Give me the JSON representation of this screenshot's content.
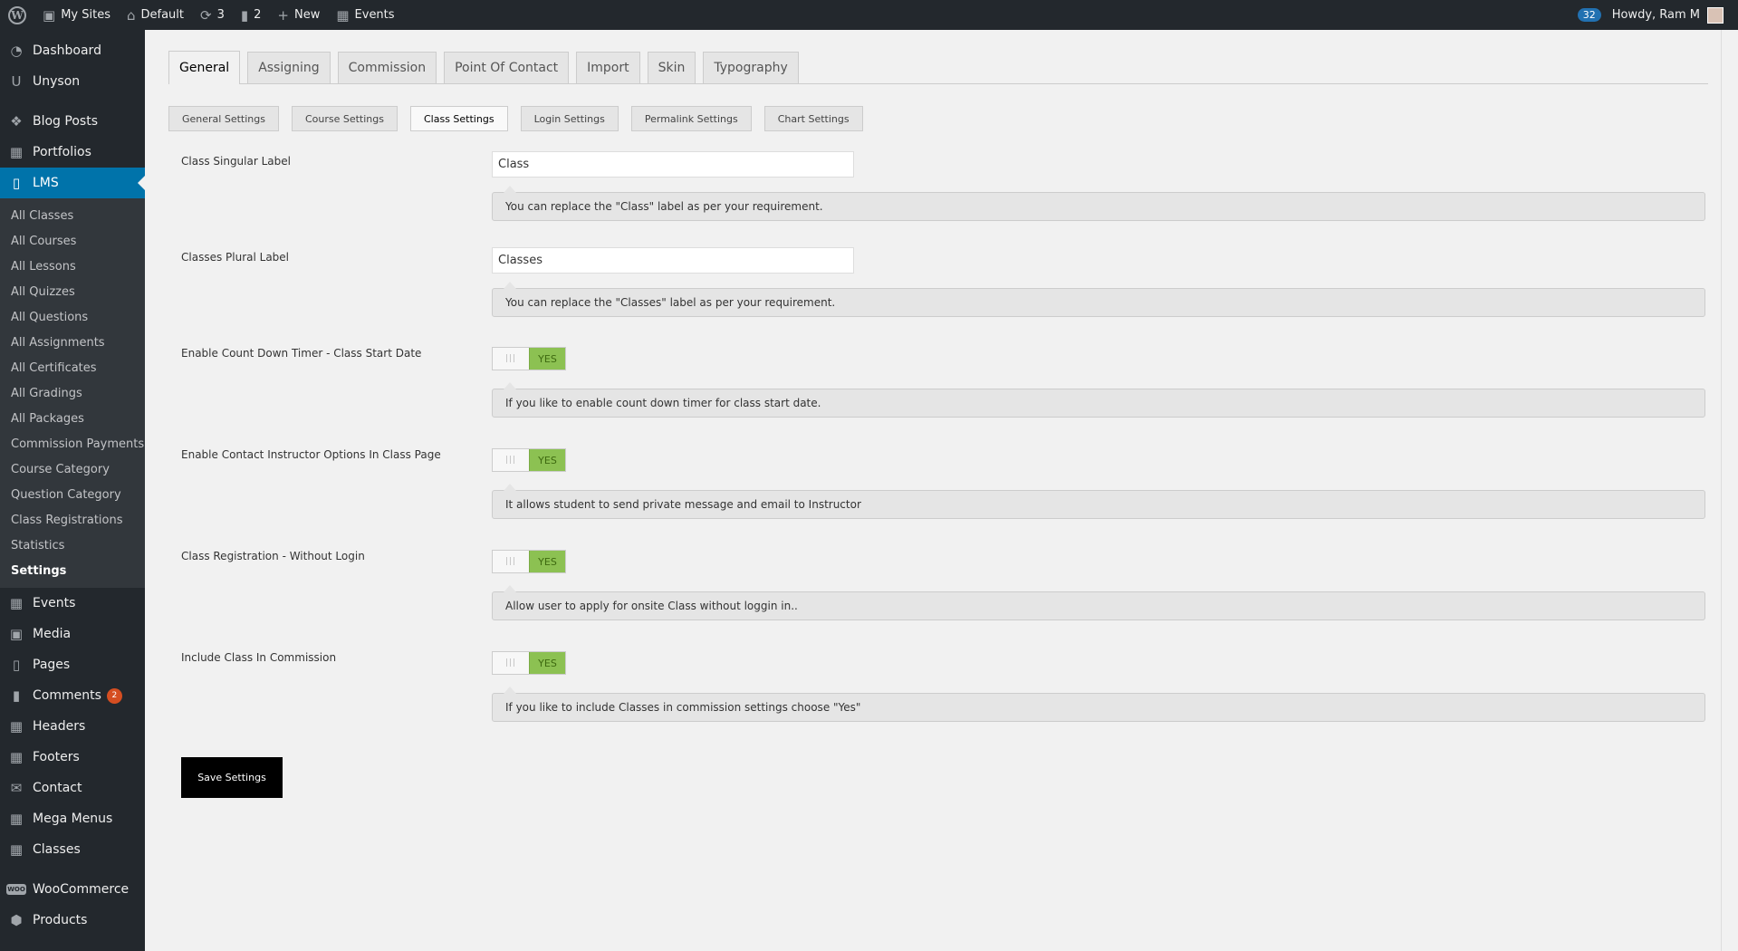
{
  "adminbar": {
    "my_sites": "My Sites",
    "site_name": "Default",
    "updates_count": "3",
    "comments_count": "2",
    "new_label": "New",
    "events_label": "Events",
    "notifications_count": "32",
    "howdy": "Howdy, Ram M"
  },
  "sidebar": {
    "top": [
      {
        "label": "Dashboard",
        "icon": "dashboard-icon"
      },
      {
        "label": "Unyson",
        "icon": "unyson-icon"
      }
    ],
    "group2": [
      {
        "label": "Blog Posts",
        "icon": "pin-icon"
      },
      {
        "label": "Portfolios",
        "icon": "portfolio-icon"
      }
    ],
    "active": {
      "label": "LMS",
      "icon": "book-icon"
    },
    "submenu": [
      "All Classes",
      "All Courses",
      "All Lessons",
      "All Quizzes",
      "All Questions",
      "All Assignments",
      "All Certificates",
      "All Gradings",
      "All Packages",
      "Commission Payments",
      "Course Category",
      "Question Category",
      "Class Registrations",
      "Statistics",
      "Settings"
    ],
    "submenu_current": "Settings",
    "group3": [
      {
        "label": "Events",
        "icon": "calendar-icon"
      },
      {
        "label": "Media",
        "icon": "media-icon"
      },
      {
        "label": "Pages",
        "icon": "pages-icon"
      },
      {
        "label": "Comments",
        "icon": "comment-icon",
        "badge": "2"
      },
      {
        "label": "Headers",
        "icon": "grid-icon"
      },
      {
        "label": "Footers",
        "icon": "grid-icon"
      },
      {
        "label": "Contact",
        "icon": "envelope-icon"
      },
      {
        "label": "Mega Menus",
        "icon": "grid-icon"
      },
      {
        "label": "Classes",
        "icon": "calendar-icon"
      }
    ],
    "group4": [
      {
        "label": "WooCommerce",
        "icon": "woo-icon"
      },
      {
        "label": "Products",
        "icon": "products-icon"
      }
    ]
  },
  "tabs_primary": [
    "General",
    "Assigning",
    "Commission",
    "Point Of Contact",
    "Import",
    "Skin",
    "Typography"
  ],
  "tabs_primary_active": "General",
  "tabs_secondary": [
    "General Settings",
    "Course Settings",
    "Class Settings",
    "Login Settings",
    "Permalink Settings",
    "Chart Settings"
  ],
  "tabs_secondary_active": "Class Settings",
  "settings": {
    "singular": {
      "label": "Class Singular Label",
      "value": "Class",
      "desc": "You can replace the \"Class\" label as per your requirement."
    },
    "plural": {
      "label": "Classes Plural Label",
      "value": "Classes",
      "desc": "You can replace the \"Classes\" label as per your requirement."
    },
    "countdown": {
      "label": "Enable Count Down Timer - Class Start Date",
      "toggle": "YES",
      "desc": "If you like to enable count down timer for class start date."
    },
    "contact": {
      "label": "Enable Contact Instructor Options In Class Page",
      "toggle": "YES",
      "desc": "It allows student to send private message and email to Instructor"
    },
    "registration": {
      "label": "Class Registration - Without Login",
      "toggle": "YES",
      "desc": "Allow user to apply for onsite Class without loggin in.."
    },
    "commission": {
      "label": "Include Class In Commission",
      "toggle": "YES",
      "desc": "If you like to include Classes in commission settings choose \"Yes\""
    }
  },
  "save_label": "Save Settings",
  "colors": {
    "accent": "#0073aa",
    "toggle_on": "#8cc152",
    "adminbar": "#23282d"
  }
}
